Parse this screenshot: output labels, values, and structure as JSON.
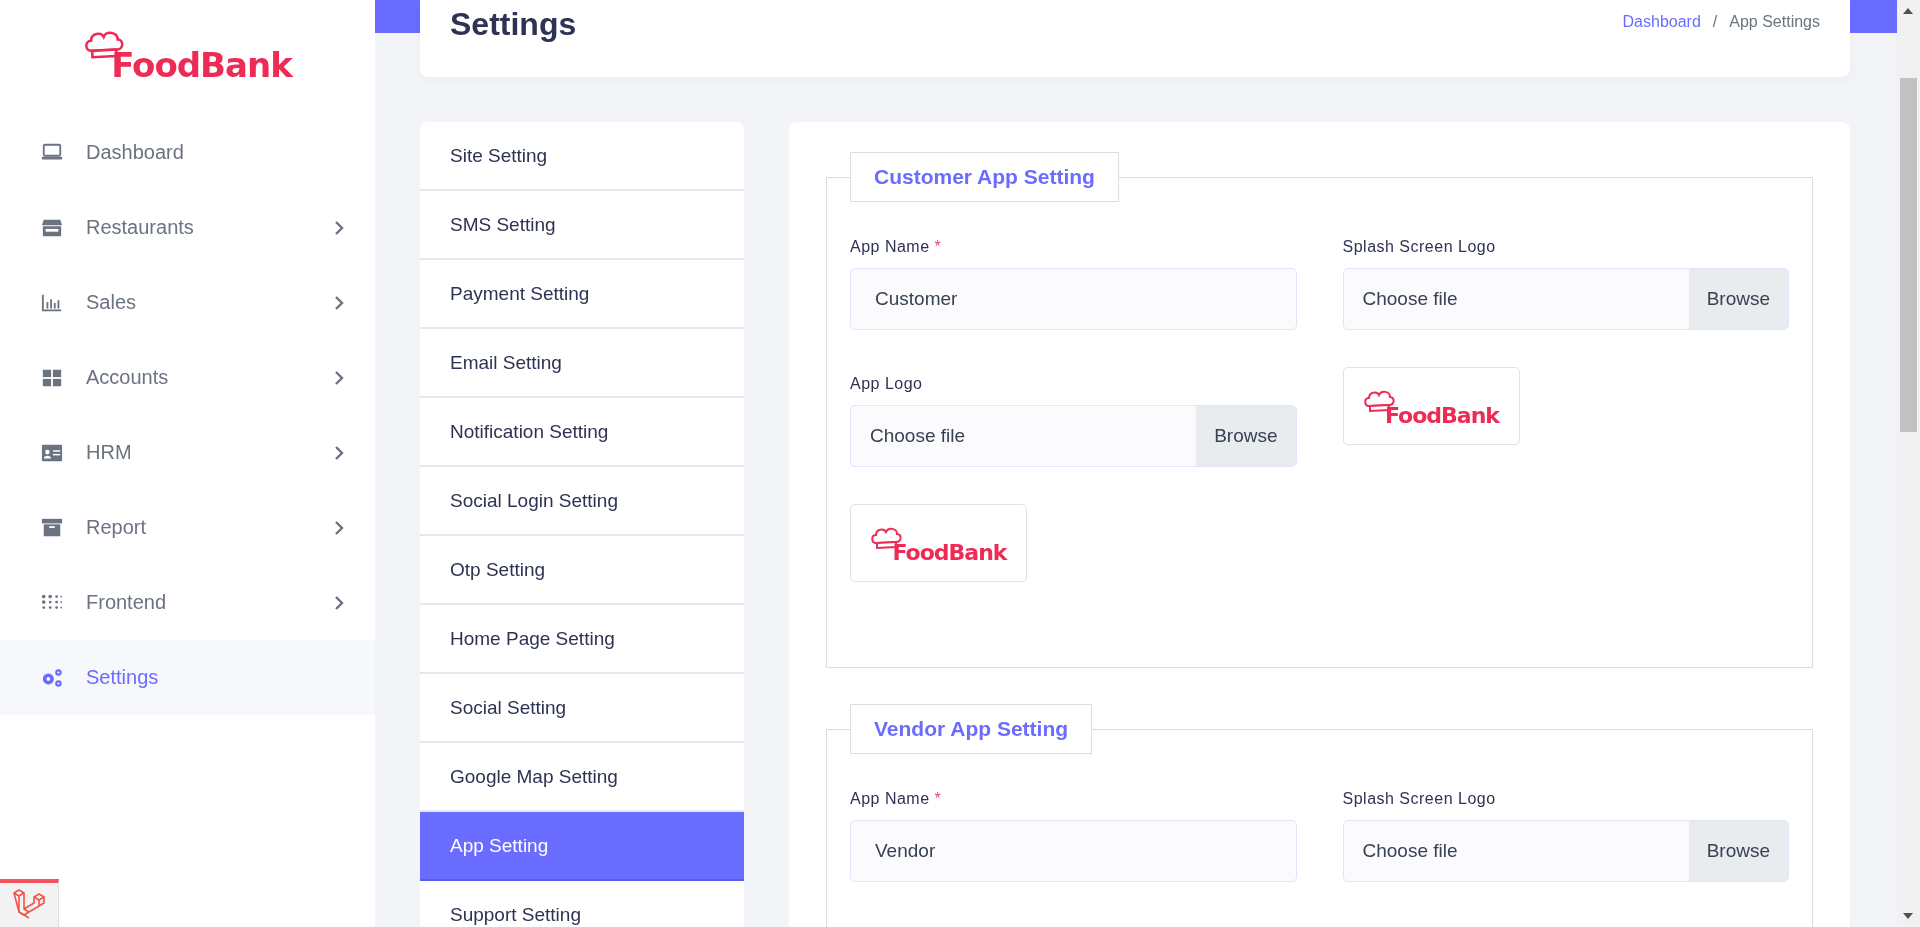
{
  "brand": {
    "name": "FoodBank"
  },
  "nav": [
    {
      "label": "Dashboard",
      "has_children": false,
      "selected": false
    },
    {
      "label": "Restaurants",
      "has_children": true,
      "selected": false
    },
    {
      "label": "Sales",
      "has_children": true,
      "selected": false
    },
    {
      "label": "Accounts",
      "has_children": true,
      "selected": false
    },
    {
      "label": "HRM",
      "has_children": true,
      "selected": false
    },
    {
      "label": "Report",
      "has_children": true,
      "selected": false
    },
    {
      "label": "Frontend",
      "has_children": true,
      "selected": false
    },
    {
      "label": "Settings",
      "has_children": false,
      "selected": true
    }
  ],
  "page": {
    "title": "Settings",
    "breadcrumb": [
      {
        "label": "Dashboard",
        "kind": "link"
      },
      {
        "label": "/",
        "kind": "separator"
      },
      {
        "label": "App Settings",
        "kind": "current"
      }
    ]
  },
  "settings_menu": [
    {
      "label": "Site Setting",
      "selected": false
    },
    {
      "label": "SMS Setting",
      "selected": false
    },
    {
      "label": "Payment Setting",
      "selected": false
    },
    {
      "label": "Email Setting",
      "selected": false
    },
    {
      "label": "Notification Setting",
      "selected": false
    },
    {
      "label": "Social Login Setting",
      "selected": false
    },
    {
      "label": "Otp Setting",
      "selected": false
    },
    {
      "label": "Home Page Setting",
      "selected": false
    },
    {
      "label": "Social Setting",
      "selected": false
    },
    {
      "label": "Google Map Setting",
      "selected": false
    },
    {
      "label": "App Setting",
      "selected": true
    },
    {
      "label": "Support Setting",
      "selected": false
    }
  ],
  "sections": [
    {
      "legend": "Customer App Setting",
      "columns": [
        [
          {
            "kind": "text",
            "label": "App Name",
            "required_mark": "*",
            "value": "Customer"
          },
          {
            "kind": "file",
            "label": "App Logo",
            "file_label": "Choose file",
            "button": "Browse",
            "preview": {
              "text": "FoodBank"
            }
          }
        ],
        [
          {
            "kind": "file",
            "label": "Splash Screen Logo",
            "file_label": "Choose file",
            "button": "Browse",
            "preview": {
              "text": "FoodBank"
            }
          }
        ]
      ]
    },
    {
      "legend": "Vendor App Setting",
      "columns": [
        [
          {
            "kind": "text",
            "label": "App Name",
            "required_mark": "*",
            "value": "Vendor"
          }
        ],
        [
          {
            "kind": "file",
            "label": "Splash Screen Logo",
            "file_label": "Choose file",
            "button": "Browse"
          }
        ]
      ]
    }
  ]
}
